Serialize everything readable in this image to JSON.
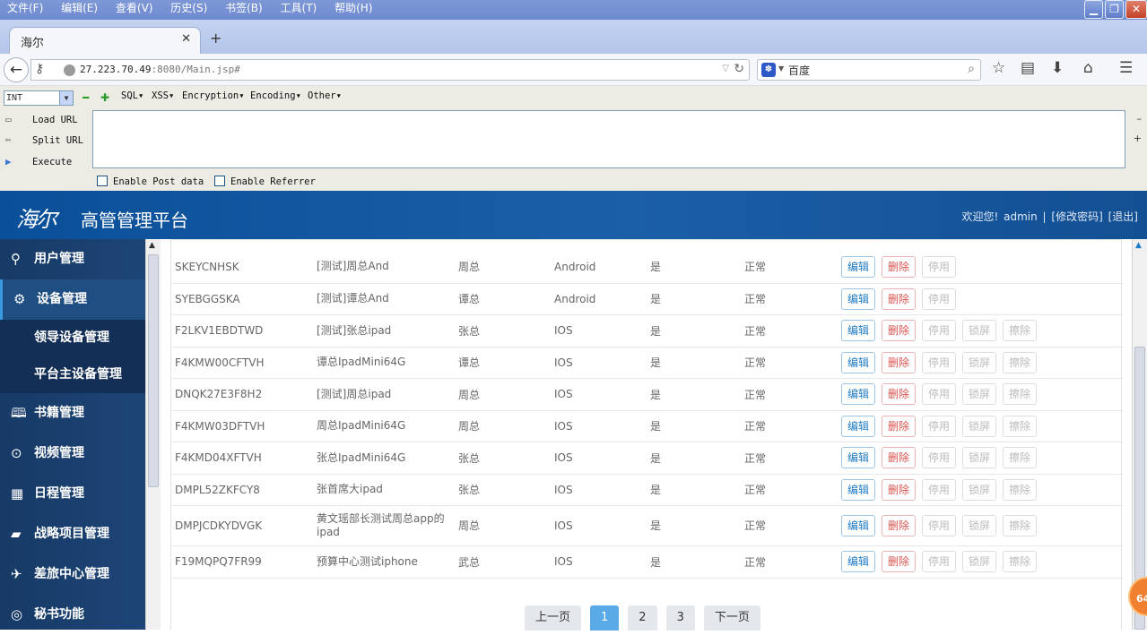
{
  "menubar": [
    "文件(F)",
    "编辑(E)",
    "查看(V)",
    "历史(S)",
    "书签(B)",
    "工具(T)",
    "帮助(H)"
  ],
  "tab": {
    "title": "海尔"
  },
  "nav": {
    "url_host": "27.223.70.49",
    "url_rest": ":8080/Main.jsp#",
    "search_engine": "百度"
  },
  "hackbar": {
    "select_value": "INT",
    "menus": [
      "SQL▾",
      "XSS▾",
      "Encryption▾",
      "Encoding▾",
      "Other▾"
    ],
    "actions": [
      "Load URL",
      "Split URL",
      "Execute"
    ],
    "checks": [
      "Enable Post data",
      "Enable Referrer"
    ]
  },
  "header": {
    "logo": "海尔",
    "title": "高管管理平台",
    "welcome": "欢迎您!",
    "user": "admin",
    "sep": "|",
    "change_pwd": "[修改密码]",
    "logout": "[退出]"
  },
  "sidebar": {
    "items": [
      {
        "label": "用户管理",
        "icon": "user-icon"
      },
      {
        "label": "设备管理",
        "icon": "gear-icon"
      },
      {
        "label": "书籍管理",
        "icon": "book-icon"
      },
      {
        "label": "视频管理",
        "icon": "play-icon"
      },
      {
        "label": "日程管理",
        "icon": "calendar-icon"
      },
      {
        "label": "战略项目管理",
        "icon": "folder-icon"
      },
      {
        "label": "差旅中心管理",
        "icon": "plane-icon"
      },
      {
        "label": "秘书功能",
        "icon": "lifebuoy-icon"
      }
    ],
    "subitems": [
      "领导设备管理",
      "平台主设备管理"
    ]
  },
  "actions": {
    "edit": "编辑",
    "delete": "删除",
    "disable": "停用",
    "lock": "锁屏",
    "wipe": "擦除"
  },
  "table": {
    "rows": [
      {
        "id": "SKEYCNHSK",
        "name": "[测试]周总And",
        "owner": "周总",
        "os": "Android",
        "flag": "是",
        "status": "正常",
        "full": false
      },
      {
        "id": "SYEBGGSKA",
        "name": "[测试]谭总And",
        "owner": "谭总",
        "os": "Android",
        "flag": "是",
        "status": "正常",
        "full": false
      },
      {
        "id": "F2LKV1EBDTWD",
        "name": "[测试]张总ipad",
        "owner": "张总",
        "os": "IOS",
        "flag": "是",
        "status": "正常",
        "full": true
      },
      {
        "id": "F4KMW00CFTVH",
        "name": "谭总IpadMini64G",
        "owner": "谭总",
        "os": "IOS",
        "flag": "是",
        "status": "正常",
        "full": true
      },
      {
        "id": "DNQK27E3F8H2",
        "name": "[测试]周总ipad",
        "owner": "周总",
        "os": "IOS",
        "flag": "是",
        "status": "正常",
        "full": true
      },
      {
        "id": "F4KMW03DFTVH",
        "name": "周总IpadMini64G",
        "owner": "周总",
        "os": "IOS",
        "flag": "是",
        "status": "正常",
        "full": true
      },
      {
        "id": "F4KMD04XFTVH",
        "name": "张总IpadMini64G",
        "owner": "张总",
        "os": "IOS",
        "flag": "是",
        "status": "正常",
        "full": true
      },
      {
        "id": "DMPL52ZKFCY8",
        "name": "张首席大ipad",
        "owner": "张总",
        "os": "IOS",
        "flag": "是",
        "status": "正常",
        "full": true
      },
      {
        "id": "DMPJCDKYDVGK",
        "name": "黄文瑶部长测试周总app的ipad",
        "owner": "周总",
        "os": "IOS",
        "flag": "是",
        "status": "正常",
        "full": true
      },
      {
        "id": "F19MQPQ7FR99",
        "name": "预算中心测试iphone",
        "owner": "武总",
        "os": "IOS",
        "flag": "是",
        "status": "正常",
        "full": true
      }
    ]
  },
  "pager": {
    "prev": "上一页",
    "pages": [
      "1",
      "2",
      "3"
    ],
    "current": "1",
    "next": "下一页"
  },
  "badge": "64"
}
